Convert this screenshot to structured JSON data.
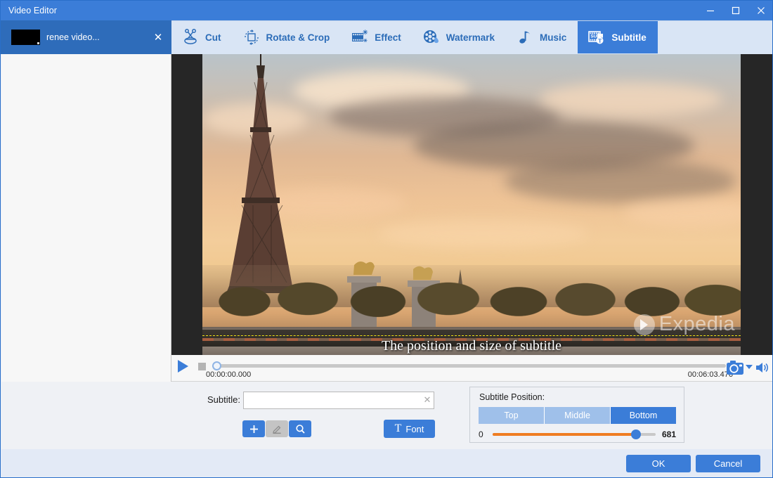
{
  "window": {
    "title": "Video Editor",
    "minimize_icon": "minimize-icon",
    "maximize_icon": "maximize-icon",
    "close_icon": "close-icon"
  },
  "file_tab": {
    "name": "renee video...",
    "close_label": "✕"
  },
  "toolbar": {
    "items": [
      {
        "label": "Cut",
        "icon": "scissors-icon",
        "active": false
      },
      {
        "label": "Rotate & Crop",
        "icon": "rotate-crop-icon",
        "active": false
      },
      {
        "label": "Effect",
        "icon": "effect-film-icon",
        "active": false
      },
      {
        "label": "Watermark",
        "icon": "watermark-film-drop-icon",
        "active": false
      },
      {
        "label": "Music",
        "icon": "music-note-icon",
        "active": false
      },
      {
        "label": "Subtitle",
        "icon": "subtitle-film-icon",
        "active": true
      }
    ]
  },
  "preview": {
    "subtitle_overlay_text": "The position and size of subtitle",
    "watermark_text": "Expedia",
    "scene_description": "Eiffel Tower and Pont Alexandre III at sunset"
  },
  "transport": {
    "play_icon": "play-icon",
    "stop_icon": "stop-icon",
    "current_time": "00:00:00.000",
    "total_time": "00:06:03.476",
    "progress_percent": 0,
    "snapshot_icon": "camera-icon",
    "snapshot_dropdown_icon": "chevron-down-icon",
    "volume_icon": "volume-icon"
  },
  "subtitle_panel": {
    "label": "Subtitle:",
    "input_value": "",
    "input_placeholder": "",
    "clear_icon": "clear-x-icon",
    "add_button_icon": "plus-icon",
    "edit_button_icon": "pencil-icon",
    "search_button_icon": "magnifier-icon",
    "font_button_label": "Font",
    "font_button_glyph": "T"
  },
  "subtitle_position": {
    "title": "Subtitle Position:",
    "options": [
      "Top",
      "Middle",
      "Bottom"
    ],
    "selected": "Bottom",
    "slider_min": "0",
    "slider_max": "681",
    "slider_value_percent": 88
  },
  "footer": {
    "ok_label": "OK",
    "cancel_label": "Cancel"
  },
  "colors": {
    "titlebar_blue": "#3b7dd8",
    "tab_blue": "#2e6cba",
    "toolbar_bg": "#d9e5f5",
    "accent_blue": "#3b7dd8",
    "slider_orange": "#ef7d22",
    "panel_bg": "#eff1f5",
    "footer_bg": "#e3eaf6"
  }
}
